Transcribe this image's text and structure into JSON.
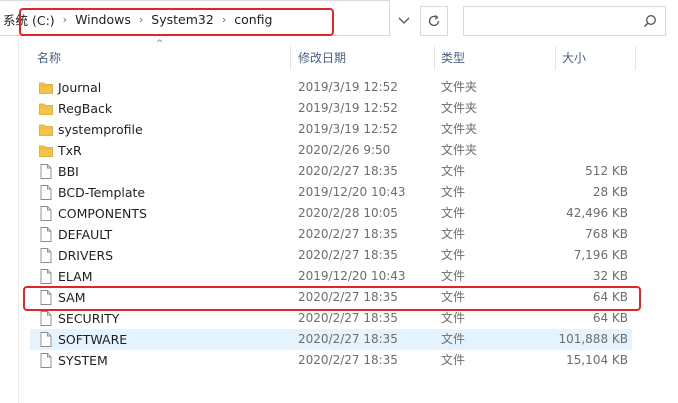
{
  "address_bar": {
    "crumbs": [
      "系统 (C:)",
      "Windows",
      "System32",
      "config"
    ],
    "separator": "›",
    "dropdown_icon": "chevron-down-icon",
    "refresh_icon": "refresh-icon"
  },
  "search": {
    "placeholder": "",
    "icon": "search-icon"
  },
  "columns": {
    "name": "名称",
    "date": "修改日期",
    "type": "类型",
    "size": "大小"
  },
  "files": [
    {
      "name": "Journal",
      "date": "2019/3/19 12:52",
      "type": "文件夹",
      "size": "",
      "kind": "folder"
    },
    {
      "name": "RegBack",
      "date": "2019/3/19 12:52",
      "type": "文件夹",
      "size": "",
      "kind": "folder"
    },
    {
      "name": "systemprofile",
      "date": "2019/3/19 12:52",
      "type": "文件夹",
      "size": "",
      "kind": "folder"
    },
    {
      "name": "TxR",
      "date": "2020/2/26 9:50",
      "type": "文件夹",
      "size": "",
      "kind": "folder"
    },
    {
      "name": "BBI",
      "date": "2020/2/27 18:35",
      "type": "文件",
      "size": "512 KB",
      "kind": "file"
    },
    {
      "name": "BCD-Template",
      "date": "2019/12/20 10:43",
      "type": "文件",
      "size": "28 KB",
      "kind": "file"
    },
    {
      "name": "COMPONENTS",
      "date": "2020/2/28 10:05",
      "type": "文件",
      "size": "42,496 KB",
      "kind": "file"
    },
    {
      "name": "DEFAULT",
      "date": "2020/2/27 18:35",
      "type": "文件",
      "size": "768 KB",
      "kind": "file"
    },
    {
      "name": "DRIVERS",
      "date": "2020/2/27 18:35",
      "type": "文件",
      "size": "7,196 KB",
      "kind": "file"
    },
    {
      "name": "ELAM",
      "date": "2019/12/20 10:43",
      "type": "文件",
      "size": "32 KB",
      "kind": "file"
    },
    {
      "name": "SAM",
      "date": "2020/2/27 18:35",
      "type": "文件",
      "size": "64 KB",
      "kind": "file"
    },
    {
      "name": "SECURITY",
      "date": "2020/2/27 18:35",
      "type": "文件",
      "size": "64 KB",
      "kind": "file"
    },
    {
      "name": "SOFTWARE",
      "date": "2020/2/27 18:35",
      "type": "文件",
      "size": "101,888 KB",
      "kind": "file",
      "selected": true
    },
    {
      "name": "SYSTEM",
      "date": "2020/2/27 18:35",
      "type": "文件",
      "size": "15,104 KB",
      "kind": "file"
    }
  ],
  "highlighted_row": "SAM",
  "colors": {
    "highlight": "#e0242b",
    "folder": "#f3c34a",
    "selection": "#e5f3ff",
    "header_text": "#4d6082"
  }
}
